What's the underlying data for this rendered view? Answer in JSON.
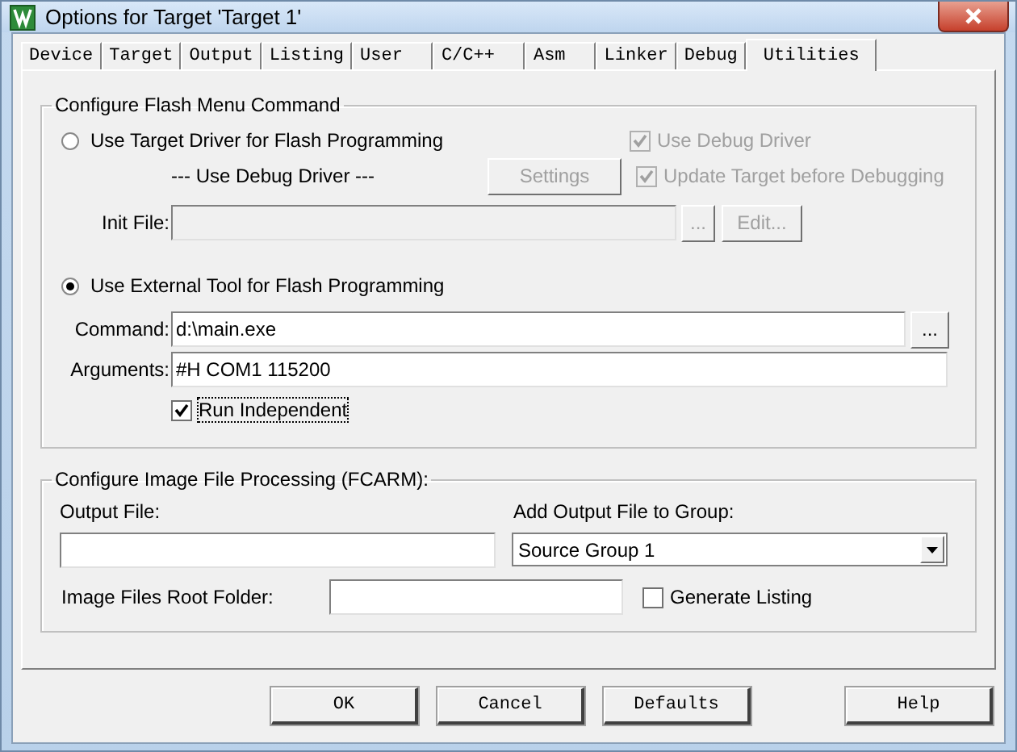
{
  "window": {
    "title": "Options for Target 'Target 1'"
  },
  "tabs": [
    {
      "label": "Device",
      "selected": false
    },
    {
      "label": "Target",
      "selected": false
    },
    {
      "label": "Output",
      "selected": false
    },
    {
      "label": "Listing",
      "selected": false
    },
    {
      "label": "User",
      "selected": false
    },
    {
      "label": "C/C++",
      "selected": false
    },
    {
      "label": "Asm",
      "selected": false
    },
    {
      "label": "Linker",
      "selected": false
    },
    {
      "label": "Debug",
      "selected": false
    },
    {
      "label": "Utilities",
      "selected": true
    }
  ],
  "flash_menu": {
    "title": "Configure Flash Menu Command",
    "target_driver": {
      "label": "Use Target Driver for Flash Programming",
      "selected": false
    },
    "debug_driver_note": "--- Use Debug Driver ---",
    "settings_button": {
      "label": "Settings",
      "disabled": true
    },
    "checkboxes": [
      {
        "label": "Use Debug Driver",
        "checked": true,
        "disabled": true
      },
      {
        "label": "Update Target before Debugging",
        "checked": true,
        "disabled": true
      }
    ],
    "init_file": {
      "label": "Init File:",
      "disabled": true
    },
    "init_browse_button": {
      "label": "...",
      "disabled": true
    },
    "edit_button": {
      "label": "Edit...",
      "disabled": true
    },
    "external_tool": {
      "label": "Use External Tool for Flash Programming",
      "selected": true
    },
    "command": {
      "label": "Command:",
      "value": "d:\\main.exe"
    },
    "command_browse_button": {
      "label": "..."
    },
    "arguments": {
      "label": "Arguments:",
      "value": "#H COM1 115200"
    },
    "run_independent": {
      "label": "Run Independent",
      "checked": true,
      "focused": true
    }
  },
  "image_processing": {
    "title": "Configure Image File Processing (FCARM):",
    "output_file_label": "Output File:",
    "group_label": "Add Output File  to Group:",
    "group_select": {
      "value": "Source Group 1"
    },
    "root_folder_label": "Image Files Root Folder:",
    "generate_listing": {
      "label": "Generate Listing",
      "checked": false
    }
  },
  "buttons": [
    {
      "label": "OK"
    },
    {
      "label": "Cancel"
    },
    {
      "label": "Defaults"
    },
    {
      "label": "Help"
    }
  ]
}
